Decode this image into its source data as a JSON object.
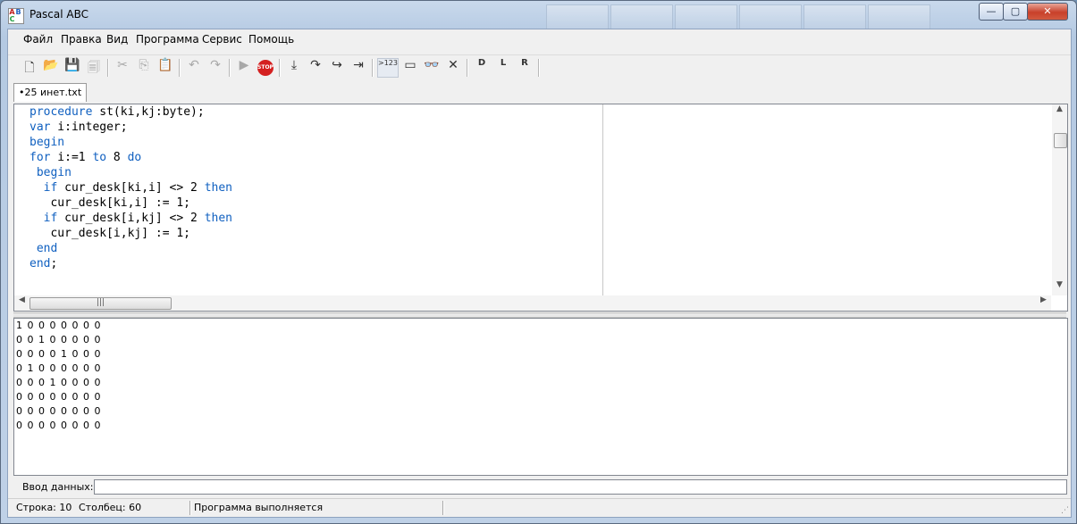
{
  "window": {
    "title": "Pascal ABC",
    "controls": {
      "minimize": "—",
      "maximize": "▢",
      "close": "✕"
    }
  },
  "menu": {
    "items": [
      "Файл",
      "Правка",
      "Вид",
      "Программа",
      "Сервис",
      "Помощь"
    ]
  },
  "toolbar": {
    "buttons": [
      {
        "name": "new-file",
        "icon": "new-file-icon",
        "glyph": "🗋",
        "enabled": true
      },
      {
        "name": "open-file",
        "icon": "folder-open-icon",
        "glyph": "📂",
        "enabled": true
      },
      {
        "name": "save",
        "icon": "save-icon",
        "glyph": "💾",
        "enabled": false
      },
      {
        "name": "save-all",
        "icon": "save-all-icon",
        "glyph": "🗐",
        "enabled": false
      },
      {
        "name": "cut",
        "icon": "cut-icon",
        "glyph": "✂",
        "enabled": false
      },
      {
        "name": "copy",
        "icon": "copy-icon",
        "glyph": "⎘",
        "enabled": false
      },
      {
        "name": "paste",
        "icon": "paste-icon",
        "glyph": "📋",
        "enabled": false
      },
      {
        "name": "undo",
        "icon": "undo-icon",
        "glyph": "↶",
        "enabled": false
      },
      {
        "name": "redo",
        "icon": "redo-icon",
        "glyph": "↷",
        "enabled": false
      },
      {
        "name": "run",
        "icon": "run-icon",
        "glyph": "▶",
        "enabled": false
      },
      {
        "name": "stop",
        "icon": "stop-icon",
        "glyph": "STOP",
        "enabled": true
      },
      {
        "name": "step-into",
        "icon": "step-into-icon",
        "glyph": "⤓",
        "enabled": true
      },
      {
        "name": "step-over",
        "icon": "step-over-icon",
        "glyph": "↷",
        "enabled": true
      },
      {
        "name": "step-out",
        "icon": "step-out-icon",
        "glyph": "↪",
        "enabled": true
      },
      {
        "name": "run-to-cursor",
        "icon": "run-to-cursor-icon",
        "glyph": "⇥",
        "enabled": true
      },
      {
        "name": "evaluate",
        "icon": "evaluate-icon",
        "glyph": ">123",
        "enabled": true
      },
      {
        "name": "output-window",
        "icon": "window-icon",
        "glyph": "▭",
        "enabled": true
      },
      {
        "name": "watch",
        "icon": "watch-icon",
        "glyph": "👓",
        "enabled": true
      },
      {
        "name": "close-debug",
        "icon": "close-icon",
        "glyph": "✕",
        "enabled": true
      },
      {
        "name": "format-d",
        "icon": "format-d-icon",
        "glyph": "D",
        "enabled": true
      },
      {
        "name": "format-l",
        "icon": "format-l-icon",
        "glyph": "L",
        "enabled": true
      },
      {
        "name": "format-r",
        "icon": "format-r-icon",
        "glyph": "R",
        "enabled": true
      }
    ]
  },
  "tabs": [
    {
      "label": "•25 инет.txt",
      "active": true
    }
  ],
  "editor": {
    "lines": [
      [
        {
          "t": "procedure",
          "k": true
        },
        {
          "t": " st(ki,kj:byte);",
          "k": false
        }
      ],
      [
        {
          "t": "var",
          "k": true
        },
        {
          "t": " i:integer;",
          "k": false
        }
      ],
      [
        {
          "t": "begin",
          "k": true
        }
      ],
      [
        {
          "t": "for",
          "k": true
        },
        {
          "t": " i:=1 ",
          "k": false
        },
        {
          "t": "to",
          "k": true
        },
        {
          "t": " 8 ",
          "k": false
        },
        {
          "t": "do",
          "k": true
        }
      ],
      [
        {
          "t": " ",
          "k": false
        },
        {
          "t": "begin",
          "k": true
        }
      ],
      [
        {
          "t": "  ",
          "k": false
        },
        {
          "t": "if",
          "k": true
        },
        {
          "t": " cur_desk[ki,i] <> 2 ",
          "k": false
        },
        {
          "t": "then",
          "k": true
        }
      ],
      [
        {
          "t": "   cur_desk[ki,i] := 1;",
          "k": false
        }
      ],
      [
        {
          "t": "  ",
          "k": false
        },
        {
          "t": "if",
          "k": true
        },
        {
          "t": " cur_desk[i,kj] <> 2 ",
          "k": false
        },
        {
          "t": "then",
          "k": true
        }
      ],
      [
        {
          "t": "   cur_desk[i,kj] := 1;",
          "k": false
        }
      ],
      [
        {
          "t": " ",
          "k": false
        },
        {
          "t": "end",
          "k": true
        }
      ],
      [
        {
          "t": "end",
          "k": true
        },
        {
          "t": ";",
          "k": false
        }
      ]
    ],
    "hscroll_thumb_glyph": "|||"
  },
  "output": {
    "lines": [
      "1 0 0 0 0 0 0 0",
      "0 0 1 0 0 0 0 0",
      "0 0 0 0 1 0 0 0",
      "0 1 0 0 0 0 0 0",
      "0 0 0 1 0 0 0 0",
      "0 0 0 0 0 0 0 0",
      "0 0 0 0 0 0 0 0",
      "0 0 0 0 0 0 0 0"
    ]
  },
  "input": {
    "label": "Ввод данных:",
    "value": ""
  },
  "status": {
    "row": "Строка: 10",
    "column": "Столбец: 60",
    "message": "Программа выполняется"
  },
  "colors": {
    "keyword": "#1060c0",
    "title_close": "#c8402a"
  }
}
